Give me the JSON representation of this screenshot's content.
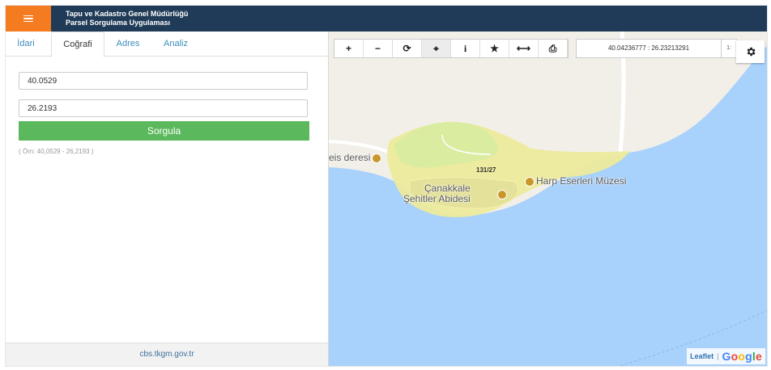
{
  "header": {
    "title_line1": "Tapu ve Kadastro Genel Müdürlüğü",
    "title_line2": "Parsel Sorgulama Uygulaması",
    "menu_icon": "hamburger-icon"
  },
  "tabs": [
    {
      "label": "İdari",
      "active": false
    },
    {
      "label": "Coğrafi",
      "active": true
    },
    {
      "label": "Adres",
      "active": false
    },
    {
      "label": "Analiz",
      "active": false
    }
  ],
  "form": {
    "latitude_value": "40.0529",
    "longitude_value": "26.2193",
    "query_button": "Sorgula",
    "hint": "( Örn: 40,0529 - 26,2193 )"
  },
  "footer": {
    "link": "cbs.tkgm.gov.tr"
  },
  "map": {
    "toolbar": [
      {
        "name": "zoom-in-icon",
        "glyph": "+"
      },
      {
        "name": "zoom-out-icon",
        "glyph": "−"
      },
      {
        "name": "refresh-icon",
        "glyph": "⟳"
      },
      {
        "name": "locate-icon",
        "glyph": "⌖"
      },
      {
        "name": "info-icon",
        "glyph": "i"
      },
      {
        "name": "star-icon",
        "glyph": "★"
      },
      {
        "name": "measure-icon",
        "glyph": "⟷"
      },
      {
        "name": "print-icon",
        "glyph": "⎙"
      }
    ],
    "coordinates": "40.04236777 : 26.23213291",
    "scale_fragment": "1:",
    "labels": {
      "deresi": "eis deresi",
      "parcel": "131/27",
      "museum": "Harp Eserleri Müzesi",
      "monument_line1": "Çanakkale",
      "monument_line2": "Şehitler Abidesi"
    },
    "attribution": {
      "leaflet": "Leaflet",
      "google": "Google"
    },
    "colors": {
      "sea": "#a8d1fb",
      "land": "#f2efe9",
      "park": "#d9ec9f",
      "parcel_fill": "#ecea9c",
      "accent_orange": "#f47b20",
      "header_navy": "#1f3b57",
      "button_green": "#5cb85c"
    }
  }
}
